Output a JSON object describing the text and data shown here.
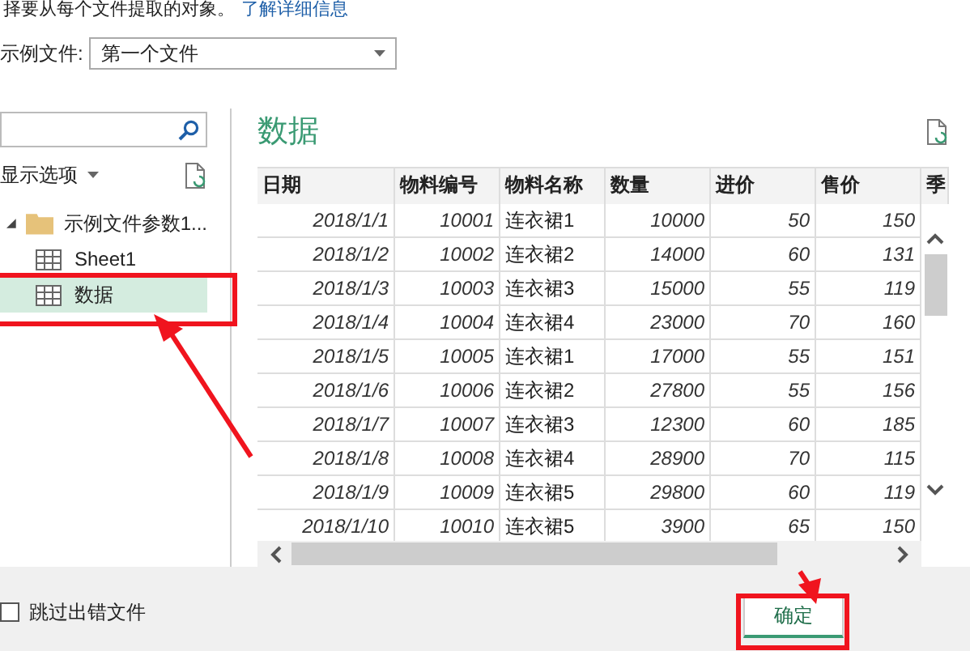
{
  "instruction": {
    "text": "择要从每个文件提取的对象。",
    "link": "了解详细信息"
  },
  "sample_file": {
    "label": "示例文件:",
    "value": "第一个文件"
  },
  "navigator": {
    "display_options": "显示选项",
    "tree": [
      {
        "label": "示例文件参数1...",
        "expanded": true,
        "children": [
          {
            "label": "Sheet1",
            "selected": false
          },
          {
            "label": "数据",
            "selected": true
          }
        ]
      }
    ]
  },
  "preview": {
    "title": "数据",
    "table": {
      "columns": [
        {
          "label": "日期",
          "kind": "number"
        },
        {
          "label": "物料编号",
          "kind": "number"
        },
        {
          "label": "物料名称",
          "kind": "text"
        },
        {
          "label": "数量",
          "kind": "number"
        },
        {
          "label": "进价",
          "kind": "number"
        },
        {
          "label": "售价",
          "kind": "number"
        },
        {
          "label": "季"
        }
      ],
      "rows": [
        [
          "2018/1/1",
          "10001",
          "连衣裙1",
          "10000",
          "50",
          "150"
        ],
        [
          "2018/1/2",
          "10002",
          "连衣裙2",
          "14000",
          "60",
          "131"
        ],
        [
          "2018/1/3",
          "10003",
          "连衣裙3",
          "15000",
          "55",
          "119"
        ],
        [
          "2018/1/4",
          "10004",
          "连衣裙4",
          "23000",
          "70",
          "160"
        ],
        [
          "2018/1/5",
          "10005",
          "连衣裙1",
          "17000",
          "55",
          "151"
        ],
        [
          "2018/1/6",
          "10006",
          "连衣裙2",
          "27800",
          "55",
          "156"
        ],
        [
          "2018/1/7",
          "10007",
          "连衣裙3",
          "12300",
          "60",
          "185"
        ],
        [
          "2018/1/8",
          "10008",
          "连衣裙4",
          "28900",
          "70",
          "115"
        ],
        [
          "2018/1/9",
          "10009",
          "连衣裙5",
          "29800",
          "60",
          "119"
        ],
        [
          "2018/1/10",
          "10010",
          "连衣裙5",
          "3900",
          "65",
          "150"
        ]
      ]
    }
  },
  "skip_errors": {
    "label": "跳过出错文件",
    "checked": false
  },
  "buttons": [
    {
      "label": "确定"
    }
  ]
}
